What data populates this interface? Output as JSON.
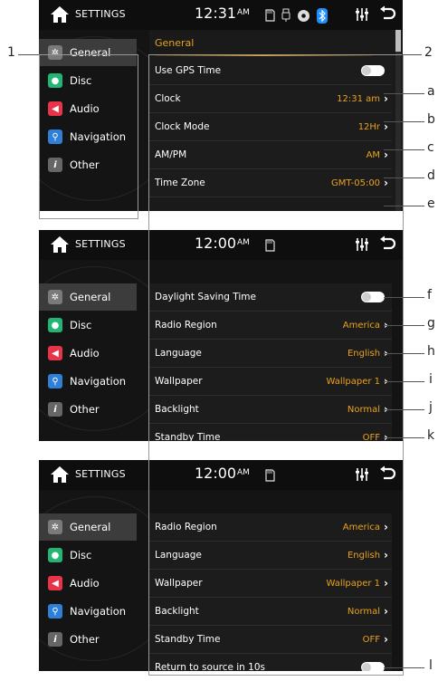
{
  "header": {
    "title": "SETTINGS",
    "am_label": "AM",
    "times": [
      "12:31",
      "12:00",
      "12:00"
    ]
  },
  "sidebar": {
    "items": [
      {
        "label": "General",
        "icon": "gear-icon",
        "color": "#7a7a7a"
      },
      {
        "label": "Disc",
        "icon": "disc-icon",
        "color": "#22b573"
      },
      {
        "label": "Audio",
        "icon": "speaker-icon",
        "color": "#e8334a"
      },
      {
        "label": "Navigation",
        "icon": "location-pin-icon",
        "color": "#2f7fd8"
      },
      {
        "label": "Other",
        "icon": "info-icon",
        "color": "#666666"
      }
    ]
  },
  "screen1": {
    "section_title": "General",
    "rows": [
      {
        "label": "Use GPS Time",
        "type": "toggle",
        "value": ""
      },
      {
        "label": "Clock",
        "type": "value",
        "value": "12:31 am"
      },
      {
        "label": "Clock Mode",
        "type": "value",
        "value": "12Hr"
      },
      {
        "label": "AM/PM",
        "type": "value",
        "value": "AM"
      },
      {
        "label": "Time Zone",
        "type": "value",
        "value": "GMT-05:00"
      }
    ]
  },
  "screen2": {
    "rows": [
      {
        "label": "Daylight Saving Time",
        "type": "toggle",
        "value": ""
      },
      {
        "label": "Radio Region",
        "type": "value",
        "value": "America"
      },
      {
        "label": "Language",
        "type": "value",
        "value": "English"
      },
      {
        "label": "Wallpaper",
        "type": "value",
        "value": "Wallpaper 1"
      },
      {
        "label": "Backlight",
        "type": "value",
        "value": "Normal"
      },
      {
        "label": "Standby Time",
        "type": "value",
        "value": "OFF"
      }
    ]
  },
  "screen3": {
    "rows": [
      {
        "label": "Radio Region",
        "type": "value",
        "value": "America"
      },
      {
        "label": "Language",
        "type": "value",
        "value": "English"
      },
      {
        "label": "Wallpaper",
        "type": "value",
        "value": "Wallpaper 1"
      },
      {
        "label": "Backlight",
        "type": "value",
        "value": "Normal"
      },
      {
        "label": "Standby Time",
        "type": "value",
        "value": "OFF"
      },
      {
        "label": "Return to source in 10s",
        "type": "toggle",
        "value": ""
      }
    ]
  },
  "callouts": {
    "left": "1",
    "right": "2",
    "letters": [
      "a",
      "b",
      "c",
      "d",
      "e",
      "f",
      "g",
      "h",
      "i",
      "j",
      "k",
      "l"
    ]
  },
  "colors": {
    "accent": "#e9a21c",
    "bluetooth": "#1e90ff"
  }
}
